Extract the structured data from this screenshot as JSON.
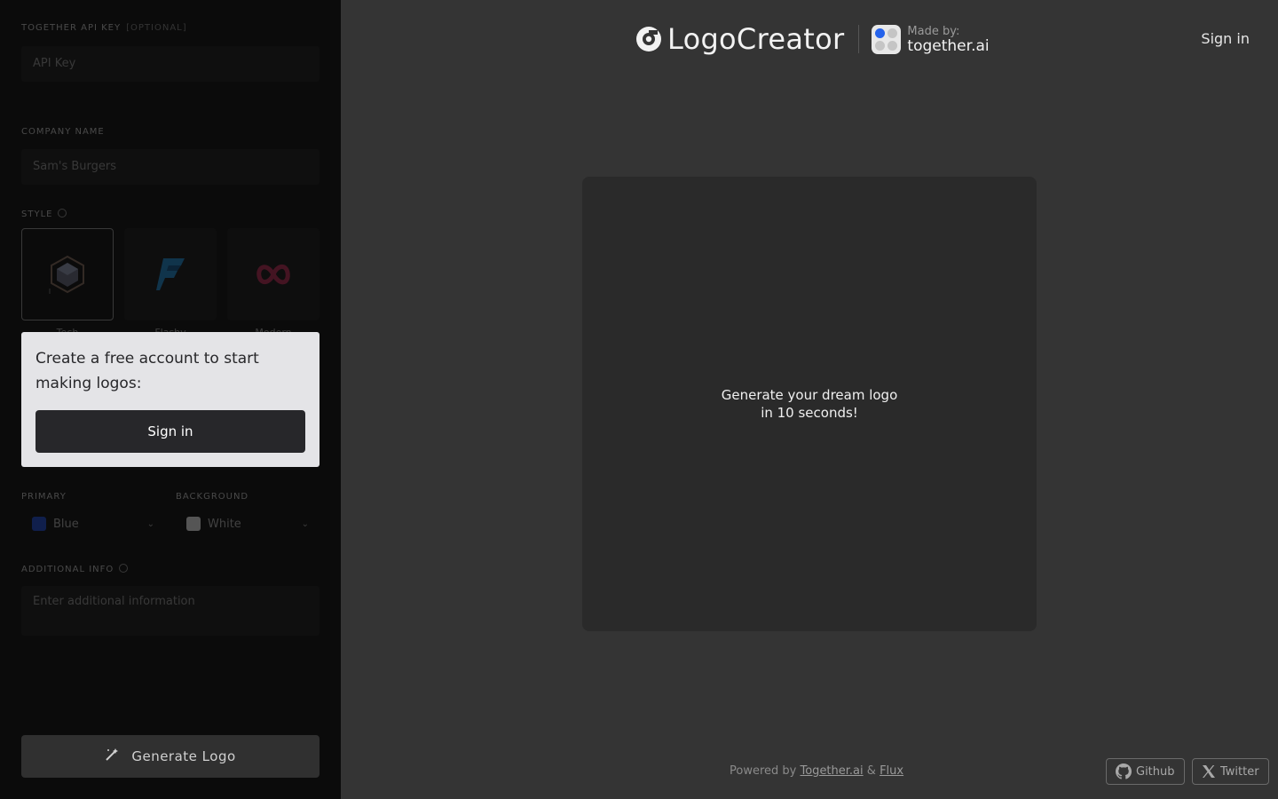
{
  "sidebar": {
    "api_key": {
      "label": "TOGETHER API KEY",
      "optional_tag": "[OPTIONAL]",
      "placeholder": "API Key"
    },
    "company_name": {
      "label": "COMPANY NAME",
      "placeholder": "Sam's Burgers"
    },
    "style": {
      "label": "STYLE",
      "options": [
        {
          "name": "Tech",
          "icon": "hexagon-cube-icon",
          "selected": true
        },
        {
          "name": "Flashy",
          "icon": "lightning-f-icon",
          "selected": false
        },
        {
          "name": "Modern",
          "icon": "infinity-swirl-icon",
          "selected": false
        }
      ]
    },
    "primary_color": {
      "label": "PRIMARY",
      "value": "Blue",
      "swatch": "#1d4ed8"
    },
    "background_color": {
      "label": "BACKGROUND",
      "value": "White",
      "swatch": "#f5f5f5"
    },
    "additional_info": {
      "label": "ADDITIONAL INFO",
      "placeholder": "Enter additional information"
    },
    "generate_button": {
      "label": "Generate Logo",
      "icon": "magic-wand-icon"
    }
  },
  "signin_card": {
    "message": "Create a free account to start making logos:",
    "button_label": "Sign in"
  },
  "header": {
    "brand_name": "LogoCreator",
    "made_by_label": "Made by:",
    "made_by_name": "together.ai",
    "sign_in_label": "Sign in"
  },
  "main": {
    "placeholder_text": "Generate your dream logo in 10 seconds!"
  },
  "footer": {
    "powered_by": "Powered by",
    "link1": "Together.ai",
    "amp": "&",
    "link2": "Flux",
    "github_label": "Github",
    "twitter_label": "Twitter"
  },
  "colors": {
    "sidebar_bg": "#0b0b0b",
    "main_bg": "#343434",
    "card_bg": "#e4e4e7",
    "accent_blue": "#2563eb"
  }
}
